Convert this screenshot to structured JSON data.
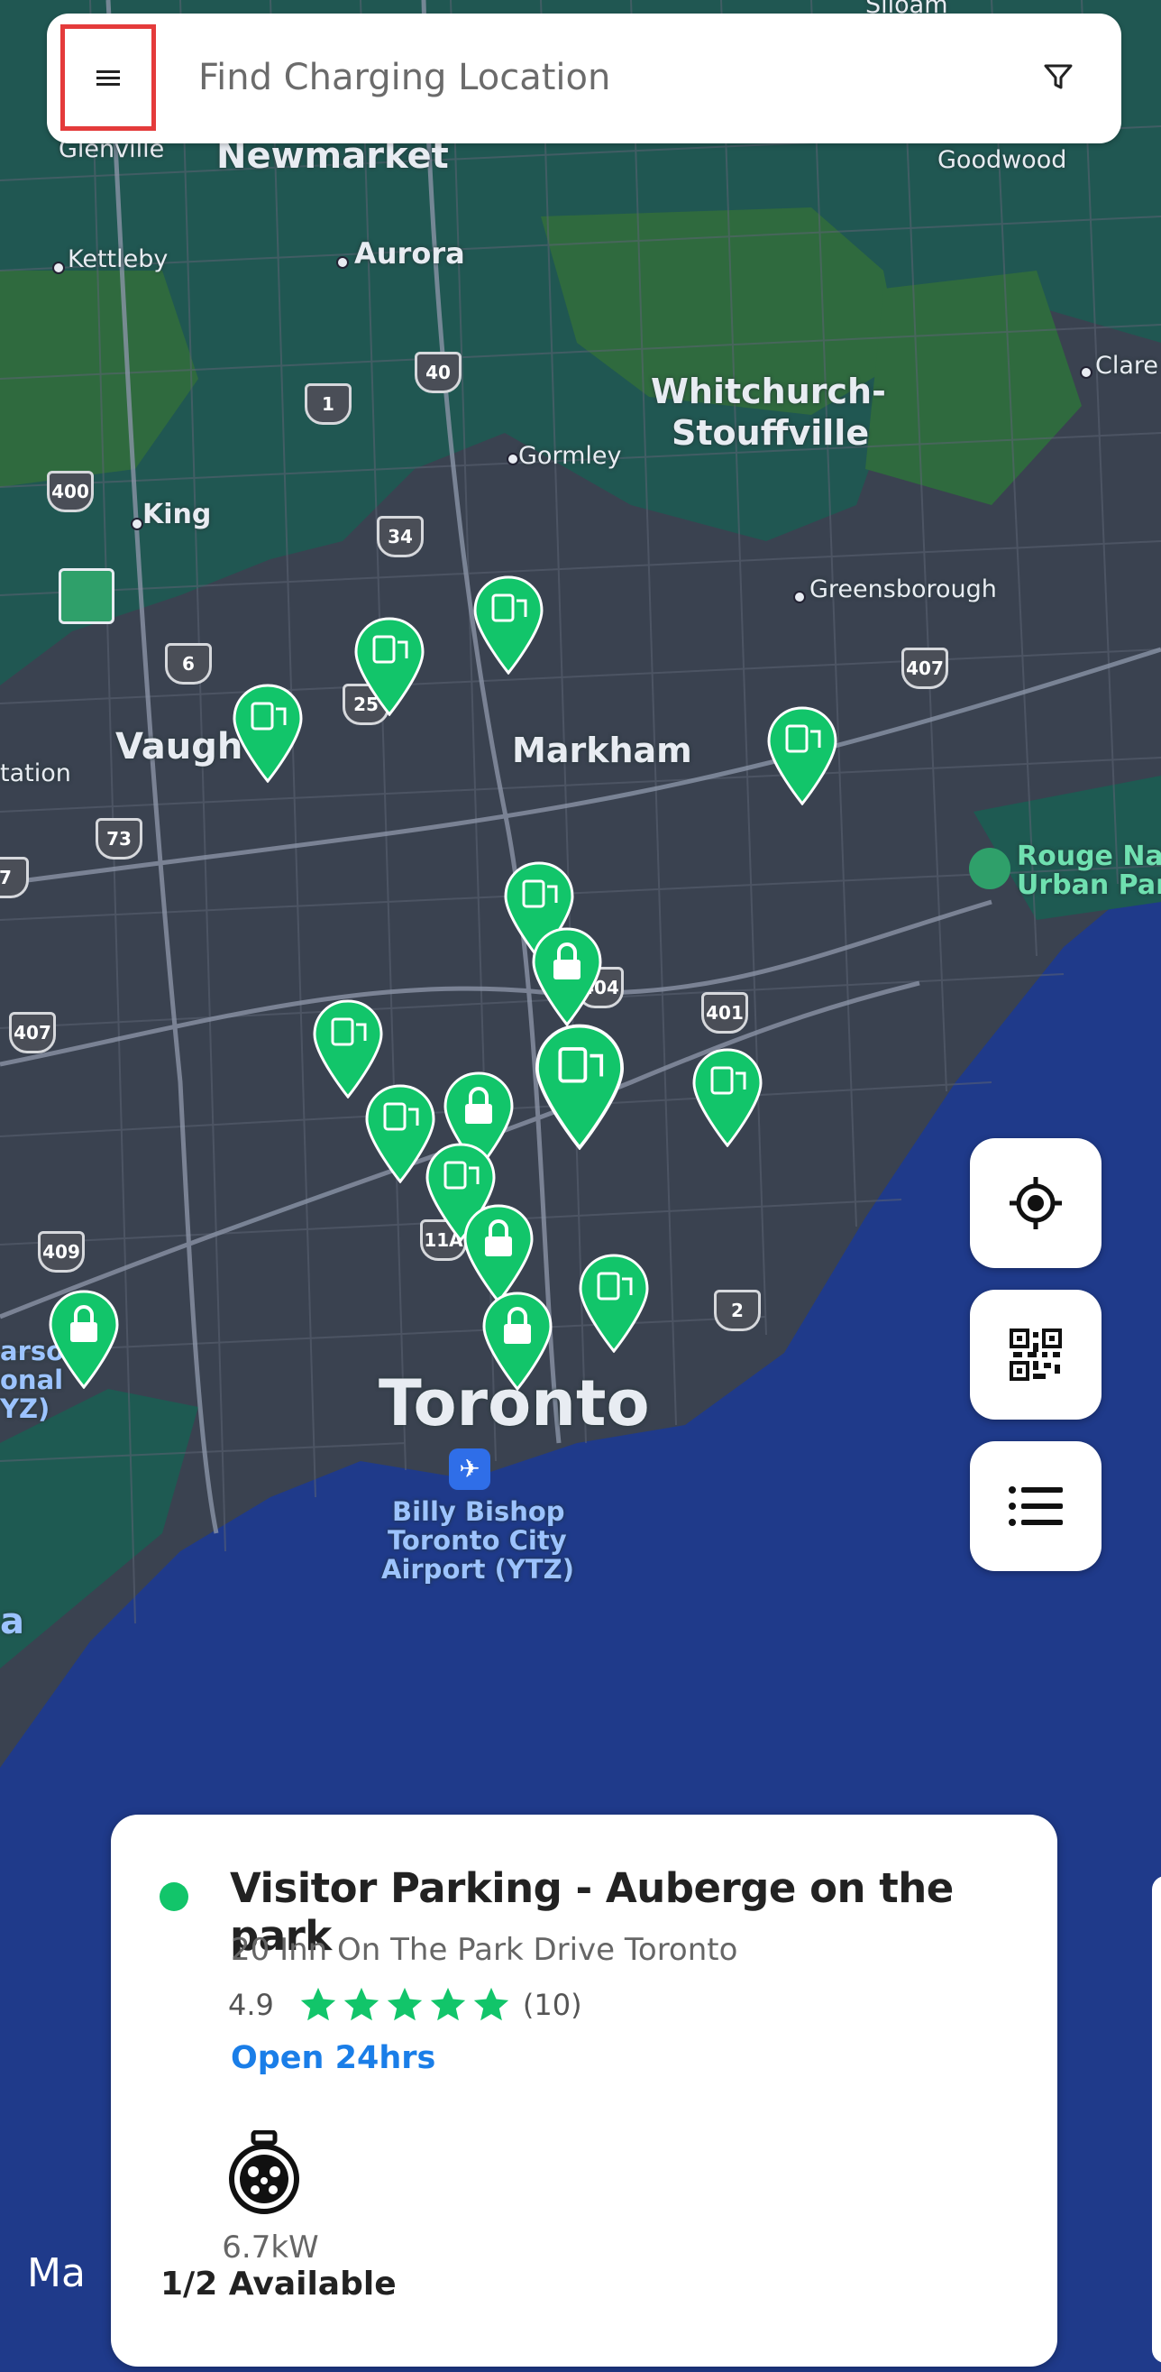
{
  "search": {
    "placeholder": "Find Charging Location"
  },
  "map": {
    "labels": {
      "newmarket": "Newmarket",
      "glenville": "Glenville",
      "kettleby": "Kettleby",
      "aurora": "Aurora",
      "goodwood": "Goodwood",
      "whitchurch1": "Whitchurch-",
      "whitchurch2": "Stouffville",
      "clare": "Clare",
      "gormley": "Gormley",
      "king": "King",
      "greensborough": "Greensborough",
      "vaughan": "Vaugh",
      "markham": "Markham",
      "station": "tation",
      "rouge1": "Rouge Nati",
      "rouge2": "Urban Park",
      "toronto": "Toronto",
      "airport1": "Billy Bishop",
      "airport2": "Toronto City",
      "airport3": "Airport (YTZ)",
      "pearson1": "arson",
      "pearson2": "onal",
      "pearson3": "YZ)",
      "sila": "Siloam",
      "a": "a"
    },
    "shields": [
      "400",
      "40",
      "1",
      "34",
      "6",
      "25",
      "73",
      "7",
      "407",
      "404",
      "401",
      "407",
      "409",
      "11A",
      "2"
    ]
  },
  "card": {
    "title": "Visitor Parking - Auberge on the park",
    "address": "20 Inn On The Park Drive Toronto",
    "rating": "4.9",
    "stars": 5,
    "review_count": "(10)",
    "hours": "Open 24hrs",
    "power": "6.7kW",
    "availability": "1/2 Available",
    "status_color": "#12c56a"
  },
  "footer": {
    "maps_logo": "Ma"
  },
  "colors": {
    "pin_green": "#12c56a",
    "accent_blue": "#1a7ee8",
    "water": "#1f3a8a",
    "highlight_red": "#e43b3b"
  }
}
